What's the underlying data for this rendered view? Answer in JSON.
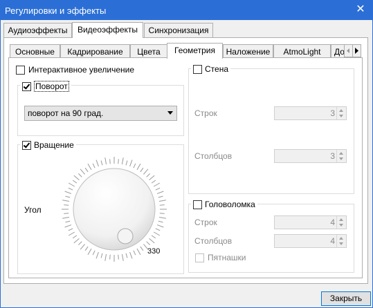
{
  "window": {
    "title": "Регулировки и эффекты",
    "close_glyph": "✕"
  },
  "main_tabs": [
    {
      "label": "Аудиоэффекты",
      "active": false
    },
    {
      "label": "Видеоэффекты",
      "active": true
    },
    {
      "label": "Синхронизация",
      "active": false
    }
  ],
  "sub_tabs": [
    {
      "label": "Основные",
      "active": false
    },
    {
      "label": "Кадрирование",
      "active": false
    },
    {
      "label": "Цвета",
      "active": false
    },
    {
      "label": "Геометрия",
      "active": true
    },
    {
      "label": "Наложение",
      "active": false
    },
    {
      "label": "AtmoLight",
      "active": false
    },
    {
      "label": "Доп.",
      "active": false
    }
  ],
  "geometry": {
    "interactive_zoom": {
      "label": "Интерактивное увеличение",
      "checked": false
    },
    "rotate": {
      "label": "Поворот",
      "checked": true,
      "select_value": "поворот на 90 град."
    },
    "rotation": {
      "label": "Вращение",
      "checked": true,
      "angle_label": "Угол",
      "angle_value": "330"
    },
    "wall": {
      "label": "Стена",
      "checked": false,
      "rows_label": "Строк",
      "rows_value": "3",
      "cols_label": "Столбцов",
      "cols_value": "3"
    },
    "puzzle": {
      "label": "Головоломка",
      "checked": false,
      "rows_label": "Строк",
      "rows_value": "4",
      "cols_label": "Столбцов",
      "cols_value": "4",
      "fifteen_label": "Пятнашки",
      "fifteen_checked": false
    }
  },
  "footer": {
    "close_button": "Закрыть"
  }
}
